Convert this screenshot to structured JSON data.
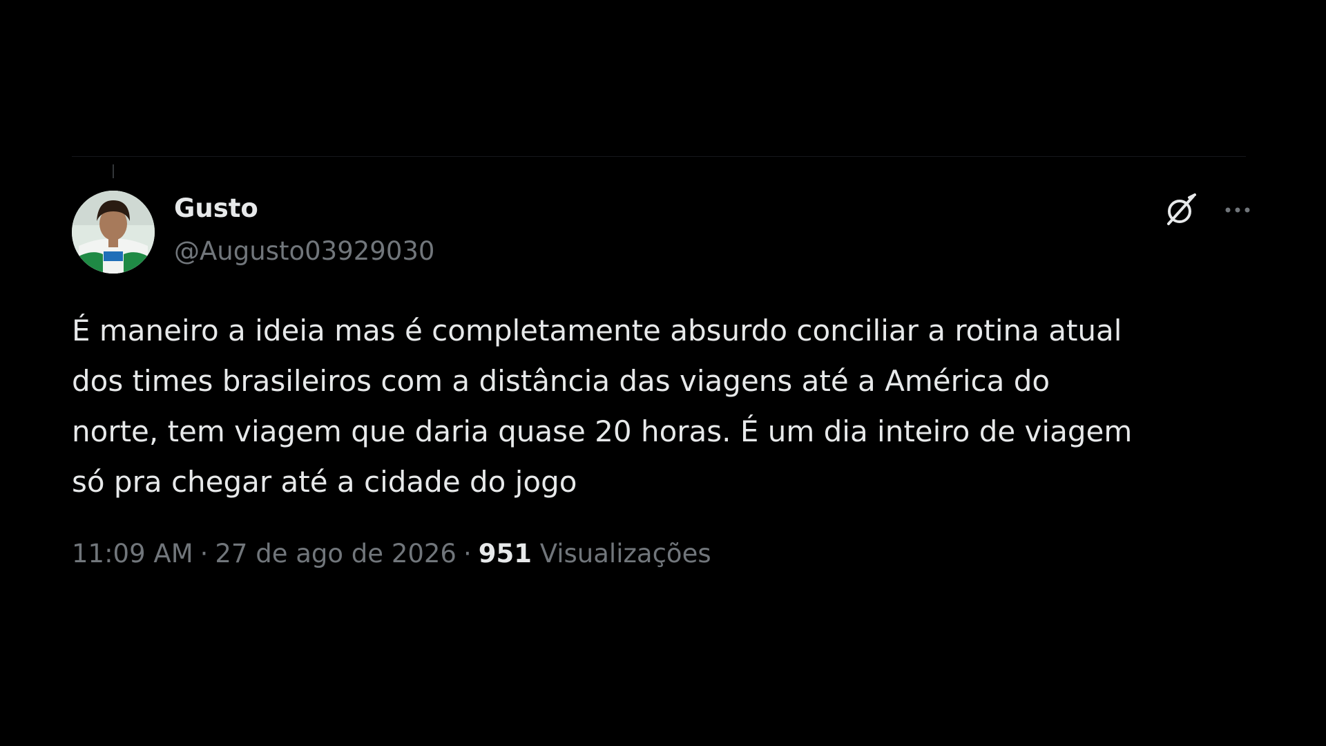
{
  "author": {
    "name": "Gusto",
    "handle": "@Augusto03929030"
  },
  "tweet": {
    "line1": "É maneiro a ideia mas é completamente absurdo conciliar a rotina atual",
    "line2": "dos times brasileiros com a distância das viagens até a América do",
    "line3": "norte, tem viagem que daria quase 20 horas. É um dia inteiro de viagem",
    "line4": "só pra chegar até a cidade do jogo"
  },
  "meta": {
    "time": "11:09 AM",
    "separator": "·",
    "date": "27 de ago de 2026",
    "views_count": "951",
    "views_label": "Visualizações"
  },
  "icons": {
    "grok": "grok-icon",
    "more": "more-icon"
  },
  "colors": {
    "background": "#000000",
    "primary_text": "#e7e9ea",
    "secondary_text": "#71767b"
  }
}
